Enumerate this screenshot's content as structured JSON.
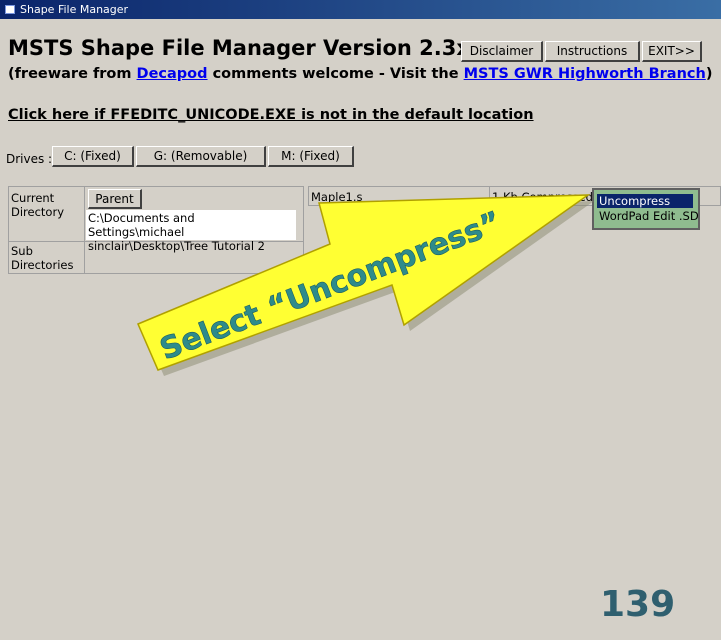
{
  "window": {
    "title": "Shape File Manager"
  },
  "header": {
    "title": "MSTS Shape File Manager Version 2.3x",
    "disclaimer_label": "Disclaimer",
    "instructions_label": "Instructions",
    "exit_label": "EXIT>>"
  },
  "subline": {
    "prefix": "(freeware from ",
    "link1": "Decapod",
    "middle": " comments welcome - Visit the ",
    "link2": "MSTS GWR Highworth Branch",
    "suffix": ")"
  },
  "ffedit_link": "Click here if FFEDITC_UNICODE.EXE is not in the default location",
  "drives": {
    "label": "Drives :",
    "items": [
      "C: (Fixed)",
      "G: (Removable)",
      "M: (Fixed)"
    ]
  },
  "directory": {
    "current_label_1": "Current",
    "current_label_2": "Directory",
    "parent_label": "Parent",
    "path_line1": "C:\\Documents and Settings\\michael",
    "path_line2": "sinclair\\Desktop\\Tree Tutorial 2",
    "sub_label_1": "Sub",
    "sub_label_2": "Directories"
  },
  "files": [
    {
      "name": "Maple1.s",
      "info": "1 Kb Compressed"
    }
  ],
  "context_menu": {
    "items": [
      "Uncompress",
      "WordPad Edit .SD"
    ],
    "selected_index": 0
  },
  "annotation": {
    "text": "Select “Uncompress”",
    "fill_color": "#ffff33",
    "text_color": "#2e8b8b"
  },
  "page_number": "139"
}
